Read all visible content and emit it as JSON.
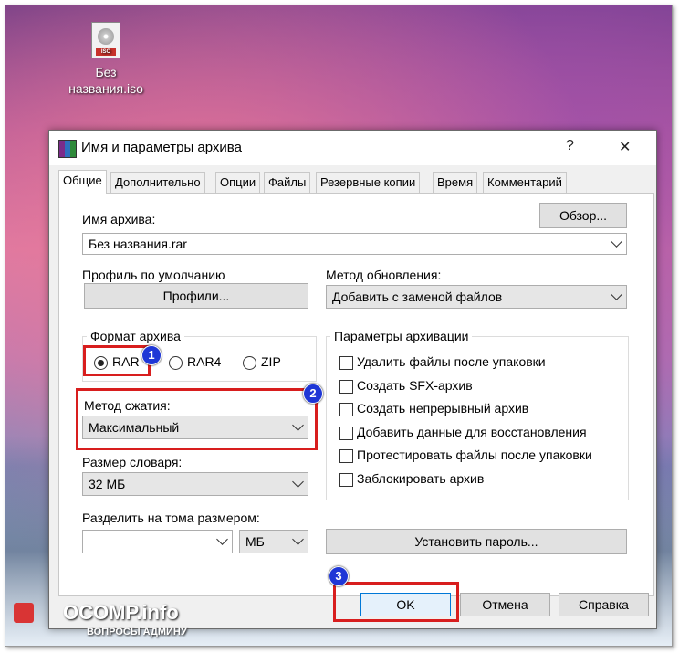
{
  "desktop": {
    "icon_label_line1": "Без",
    "icon_label_line2": "названия.iso",
    "icon_badge": "ISO"
  },
  "dialog": {
    "title": "Имя и параметры архива",
    "help": "?",
    "close": "✕",
    "tabs": [
      "Общие",
      "Дополнительно",
      "Опции",
      "Файлы",
      "Резервные копии",
      "Время",
      "Комментарий"
    ],
    "active_tab": "Общие",
    "archive_name_label": "Имя архива:",
    "browse_button": "Обзор...",
    "archive_name_value": "Без названия.rar",
    "default_profile_label": "Профиль по умолчанию",
    "profiles_button": "Профили...",
    "update_method_label": "Метод обновления:",
    "update_method_value": "Добавить с заменой файлов",
    "archive_format": {
      "label": "Формат архива",
      "options": [
        "RAR",
        "RAR4",
        "ZIP"
      ],
      "selected": "RAR"
    },
    "compression_method_label": "Метод сжатия:",
    "compression_method_value": "Максимальный",
    "dictionary_size_label": "Размер словаря:",
    "dictionary_size_value": "32 МБ",
    "split_label": "Разделить на тома размером:",
    "split_value": "",
    "split_unit": "МБ",
    "archive_options": {
      "label": "Параметры архивации",
      "items": [
        {
          "label": "Удалить файлы после упаковки",
          "checked": false
        },
        {
          "label": "Создать SFX-архив",
          "checked": false
        },
        {
          "label": "Создать непрерывный архив",
          "checked": false
        },
        {
          "label": "Добавить данные для восстановления",
          "checked": false
        },
        {
          "label": "Протестировать файлы после упаковки",
          "checked": false
        },
        {
          "label": "Заблокировать архив",
          "checked": false
        }
      ]
    },
    "set_password_button": "Установить пароль...",
    "ok_button": "OK",
    "cancel_button": "Отмена",
    "help_button": "Справка"
  },
  "annotations": {
    "badge1": "1",
    "badge2": "2",
    "badge3": "3",
    "highlight_color": "#d81e1e",
    "badge_color": "#1f37d6"
  },
  "watermark": {
    "title": "OCOMP.info",
    "subtitle": "ВОПРОСЫ АДМИНУ"
  }
}
